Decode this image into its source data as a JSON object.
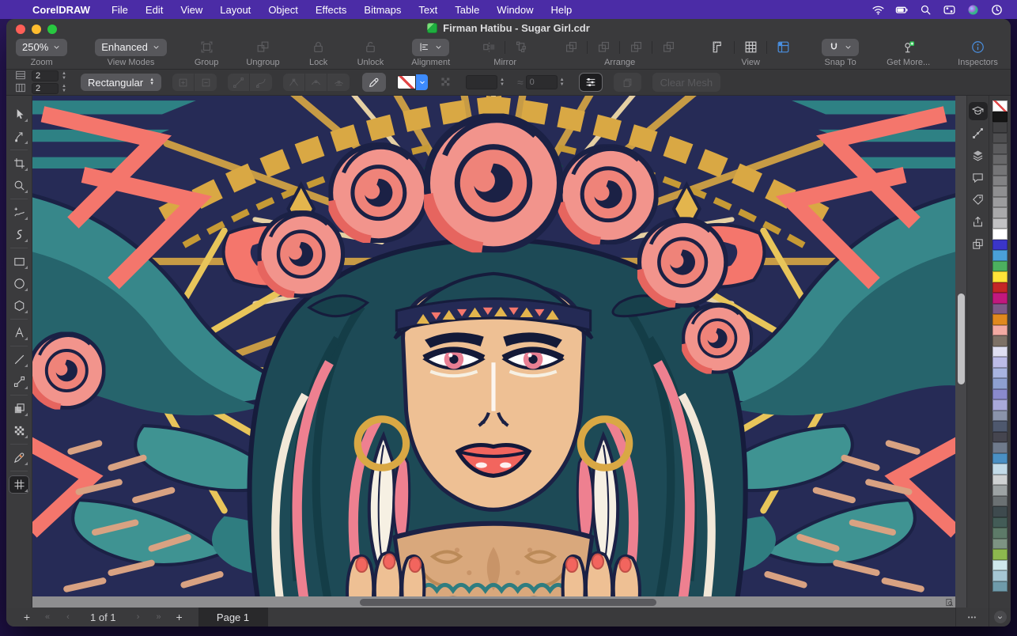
{
  "menu_bar": {
    "items": [
      {
        "name": "menu-coreldraw",
        "label": "CorelDRAW",
        "bold": true
      },
      {
        "name": "menu-file",
        "label": "File"
      },
      {
        "name": "menu-edit",
        "label": "Edit"
      },
      {
        "name": "menu-view",
        "label": "View"
      },
      {
        "name": "menu-layout",
        "label": "Layout"
      },
      {
        "name": "menu-object",
        "label": "Object"
      },
      {
        "name": "menu-effects",
        "label": "Effects"
      },
      {
        "name": "menu-bitmaps",
        "label": "Bitmaps"
      },
      {
        "name": "menu-text",
        "label": "Text"
      },
      {
        "name": "menu-table",
        "label": "Table"
      },
      {
        "name": "menu-window",
        "label": "Window"
      },
      {
        "name": "menu-help",
        "label": "Help"
      }
    ],
    "status_icons": [
      {
        "name": "wifi-icon",
        "icon": "ic-wifi"
      },
      {
        "name": "battery-icon",
        "icon": "ic-battery"
      },
      {
        "name": "spotlight-search-icon",
        "icon": "ic-search"
      },
      {
        "name": "control-center-icon",
        "icon": "ic-cc"
      },
      {
        "name": "siri-icon",
        "icon": "ic-siri"
      },
      {
        "name": "clock-icon",
        "icon": "ic-clock"
      }
    ]
  },
  "window": {
    "title": "Firman Hatibu -  Sugar Girl.cdr"
  },
  "toolbar": {
    "zoom_value": "250%",
    "zoom_label": "Zoom",
    "view_mode_value": "Enhanced",
    "view_modes_label": "View Modes",
    "group_label": "Group",
    "ungroup_label": "Ungroup",
    "lock_label": "Lock",
    "unlock_label": "Unlock",
    "alignment_label": "Alignment",
    "mirror_label": "Mirror",
    "arrange_label": "Arrange",
    "view_label": "View",
    "snap_to_label": "Snap To",
    "get_more_label": "Get More...",
    "inspectors_label": "Inspectors"
  },
  "property_bar": {
    "grid_rows": "2",
    "grid_cols": "2",
    "mesh_type": "Rectangular",
    "approx_symbol": "≈",
    "smoothness": "0",
    "transparency": "",
    "clear_mesh_label": "Clear Mesh"
  },
  "toolbox": {
    "tools": [
      {
        "name": "tool-pick",
        "icon": "ic-pick"
      },
      {
        "name": "tool-shape",
        "icon": "ic-shape"
      },
      {
        "name": "tool-crop",
        "icon": "ic-crop",
        "sep": true
      },
      {
        "name": "tool-zoom",
        "icon": "ic-zoom"
      },
      {
        "name": "tool-freehand",
        "icon": "ic-freehand",
        "sep": true
      },
      {
        "name": "tool-artistic-media",
        "icon": "ic-artistic"
      },
      {
        "name": "tool-rectangle",
        "icon": "ic-rect",
        "sep": true
      },
      {
        "name": "tool-ellipse",
        "icon": "ic-ellipse"
      },
      {
        "name": "tool-polygon",
        "icon": "ic-polygon"
      },
      {
        "name": "tool-text",
        "icon": "ic-text",
        "sep": true
      },
      {
        "name": "tool-line",
        "icon": "ic-line",
        "sep": true
      },
      {
        "name": "tool-connector",
        "icon": "ic-connector"
      },
      {
        "name": "tool-drop-shadow",
        "icon": "ic-shadow",
        "sep": true
      },
      {
        "name": "tool-pattern-fill",
        "icon": "ic-pattern"
      },
      {
        "name": "tool-smart-fill",
        "icon": "ic-smartfill",
        "sep": true
      },
      {
        "name": "tool-mesh-fill",
        "icon": "ic-mesh",
        "sep": true,
        "active": true
      }
    ]
  },
  "inspectors": {
    "items": [
      {
        "name": "hints-inspector-icon",
        "icon": "ic-hints",
        "active": true
      },
      {
        "name": "transform-inspector-icon",
        "icon": "ic-transform"
      },
      {
        "name": "objects-inspector-icon",
        "icon": "ic-objects"
      },
      {
        "name": "comments-inspector-icon",
        "icon": "ic-comment"
      },
      {
        "name": "properties-inspector-icon",
        "icon": "ic-tag"
      },
      {
        "name": "export-inspector-icon",
        "icon": "ic-export"
      },
      {
        "name": "symbols-inspector-icon",
        "icon": "ic-symbols"
      }
    ]
  },
  "palette": {
    "colors": [
      "none",
      "#161616",
      "#414143",
      "#4e4e50",
      "#5b5b5d",
      "#68686a",
      "#757577",
      "#828284",
      "#8f8f91",
      "#9c9c9e",
      "#a9a9ab",
      "#c2c2c4",
      "#ffffff",
      "#3a35c9",
      "#4aa0d8",
      "#4cb05f",
      "#ffe438",
      "#c42626",
      "#c2187e",
      "#7d5b88",
      "#e0891e",
      "#f2aaa2",
      "#7d7166",
      "#dfdff2",
      "#bcbce8",
      "#a8b4e0",
      "#8ea0d0",
      "#8a8acc",
      "#a9a9da",
      "#8a93ab",
      "#4e586e",
      "#45454f",
      "#6f7a8c",
      "#4a90c4",
      "#c3dbe8",
      "#cfd2d3",
      "#9da3a4",
      "#6b7173",
      "#3e4a4e",
      "#435c57",
      "#5d7a68",
      "#7d9383",
      "#8db84e",
      "#cfe8ec",
      "#a5c6d4",
      "#6f9bab"
    ]
  },
  "bottom_bar": {
    "add_page_left": "+",
    "first_page": "«",
    "prev_page": "‹",
    "page_indicator": "1 of 1",
    "next_page": "›",
    "last_page": "»",
    "add_page_right": "+",
    "page_tab": "Page 1",
    "more_options": "•••"
  },
  "accent_colors": {
    "menu_bar_purple": "#4b2ca6",
    "highlight_blue": "#4a90e2",
    "get_more_green": "#34c759"
  }
}
